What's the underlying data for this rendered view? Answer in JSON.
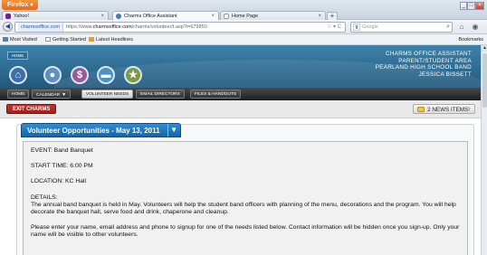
{
  "browser": {
    "firefox_label": "Firefox",
    "tabs": [
      {
        "label": "Yahoo!"
      },
      {
        "label": "Charms Office Assistant"
      },
      {
        "label": "Home Page"
      }
    ],
    "url_site": "charmsoffice.com",
    "url_prefix": "https://www.",
    "url_domain": "charmsoffice.com",
    "url_path": "/charms/volunteer/t.asp?i=679850",
    "search_placeholder": "Google",
    "bookmarks": [
      "Most Visited",
      "Getting Started",
      "Latest Headlines"
    ],
    "bookmarks_right": "Bookmarks"
  },
  "site": {
    "home_badge": "HOME",
    "header_lines": [
      "CHARMS OFFICE ASSISTANT",
      "PARENT/STUDENT AREA",
      "PEARLAND HIGH SCHOOL BAND",
      "JESSICA BISSETT"
    ],
    "menu": [
      "HOME",
      "CALENDAR",
      "VOLUNTEER NEEDS",
      "EMAIL DIRECTORS",
      "FILES & HANDOUTS"
    ],
    "exit_label": "EXIT CHARMS",
    "news_label": "2 NEWS ITEMS!"
  },
  "volunteer": {
    "panel_title": "Volunteer Opportunities - May 13, 2011",
    "event": "EVENT: Band Banquet",
    "start_time": "START TIME: 6:00 PM",
    "location": "LOCATION: KC Hall",
    "details_label": "DETAILS:",
    "details_text": "The annual band banquet is held in May.  Volunteers will help the student band officers with planning of the menu, decorations and the program.  You will help decorate the banquet hall, serve food and drink, chaperone and cleanup.",
    "instructions": "Please enter your name, email address and phone to signup for one of the needs listed below. Contact information will be hidden once you sign-up. Only your name will be visible to other volunteers."
  }
}
